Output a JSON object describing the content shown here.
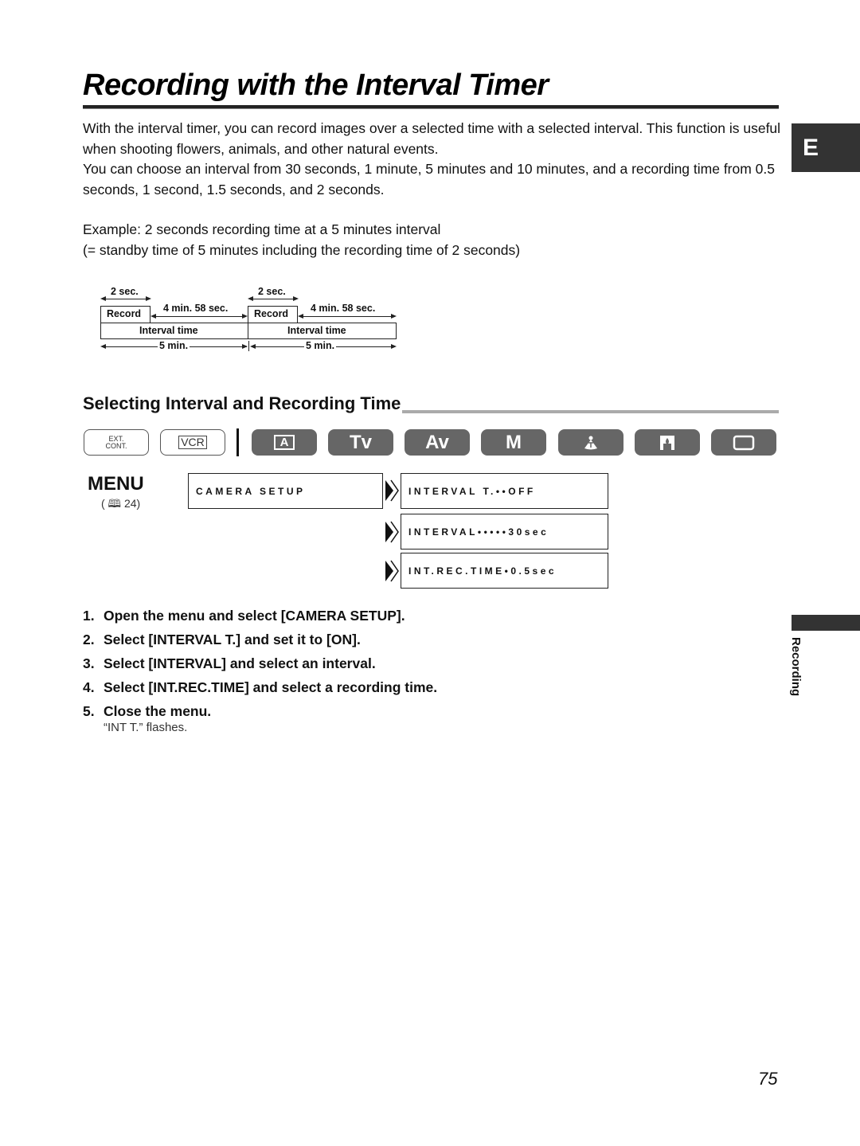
{
  "page": {
    "title": "Recording with the Interval Timer",
    "intro": [
      "With the interval timer, you can record images over a selected time with a selected interval. This function is useful when shooting flowers, animals, and other natural events.",
      "You can choose an interval from 30 seconds, 1 minute, 5 minutes and 10 minutes, and a recording time from 0.5 seconds, 1 second, 1.5 seconds, and 2 seconds."
    ],
    "example": [
      "Example: 2 seconds recording time at a 5 minutes interval",
      "(= standby time of 5 minutes including the recording time of 2 seconds)"
    ],
    "language_tab": "E",
    "chapter_tab": "Recording",
    "page_number": "75"
  },
  "diagram": {
    "record_duration": "2 sec.",
    "standby_duration": "4 min. 58 sec.",
    "record_label": "Record",
    "interval_label": "Interval time",
    "interval_duration": "5 min."
  },
  "section": {
    "title": "Selecting Interval and Recording Time"
  },
  "modes": {
    "ext_cont": [
      "EXT.",
      "CONT."
    ],
    "vcr": "VCR",
    "auto": "A",
    "tv": "Tv",
    "av": "Av",
    "m": "M",
    "icons": [
      "spotlight-icon",
      "night-icon",
      "easy-recording-icon"
    ]
  },
  "menu": {
    "logo": "MENU",
    "reference": "( 🕮 24)",
    "root": "CAMERA SETUP",
    "items": [
      "INTERVAL T.••OFF",
      "INTERVAL•••••30sec",
      "INT.REC.TIME•0.5sec"
    ]
  },
  "steps": [
    {
      "num": "1.",
      "text": "Open the menu and select [CAMERA SETUP]."
    },
    {
      "num": "2.",
      "text": "Select [INTERVAL T.] and set it to [ON]."
    },
    {
      "num": "3.",
      "text": "Select [INTERVAL] and select an interval."
    },
    {
      "num": "4.",
      "text": "Select [INT.REC.TIME] and select a recording time."
    },
    {
      "num": "5.",
      "text": "Close the menu."
    }
  ],
  "step_note": "“INT T.” flashes."
}
